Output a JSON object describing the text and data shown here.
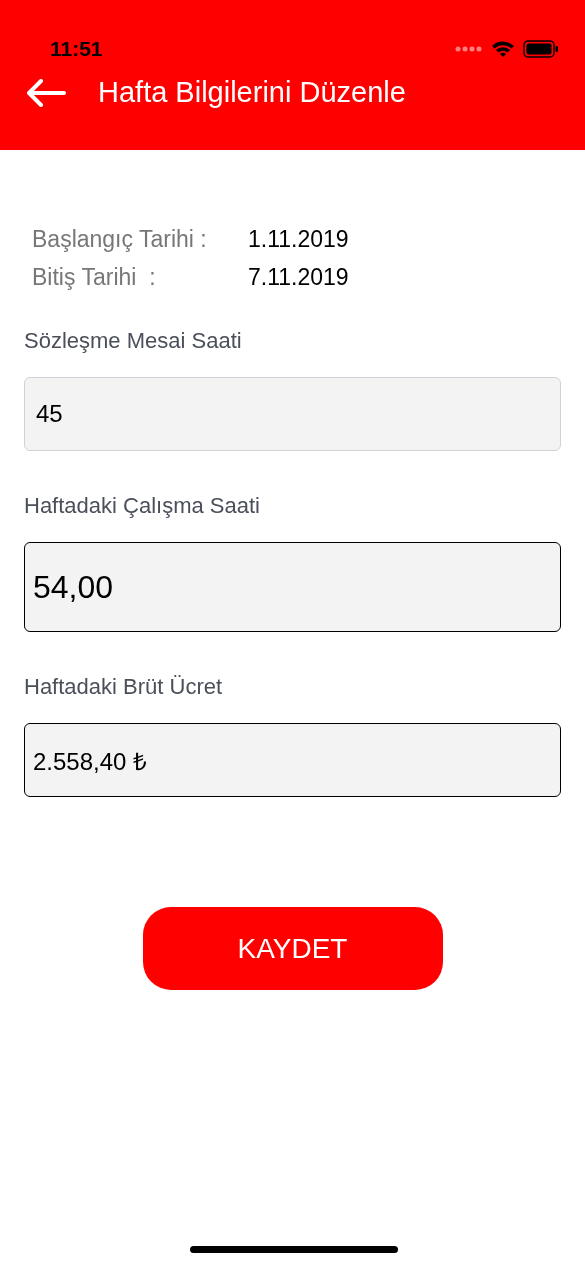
{
  "status_bar": {
    "time": "11:51"
  },
  "header": {
    "title": "Hafta Bilgilerini Düzenle"
  },
  "info": [
    {
      "label": "Başlangıç Tarihi :",
      "value": "1.11.2019"
    },
    {
      "label": "Bitiş Tarihi  :",
      "value": "7.11.2019"
    }
  ],
  "fields": [
    {
      "label": "Sözleşme Mesai Saati",
      "value": "45",
      "disabled": true
    },
    {
      "label": "Haftadaki Çalışma Saati",
      "value": "54,00",
      "disabled": false
    },
    {
      "label": "Haftadaki Brüt Ücret",
      "value": "2.558,40 ₺",
      "disabled": false
    }
  ],
  "button": {
    "label": "KAYDET"
  }
}
